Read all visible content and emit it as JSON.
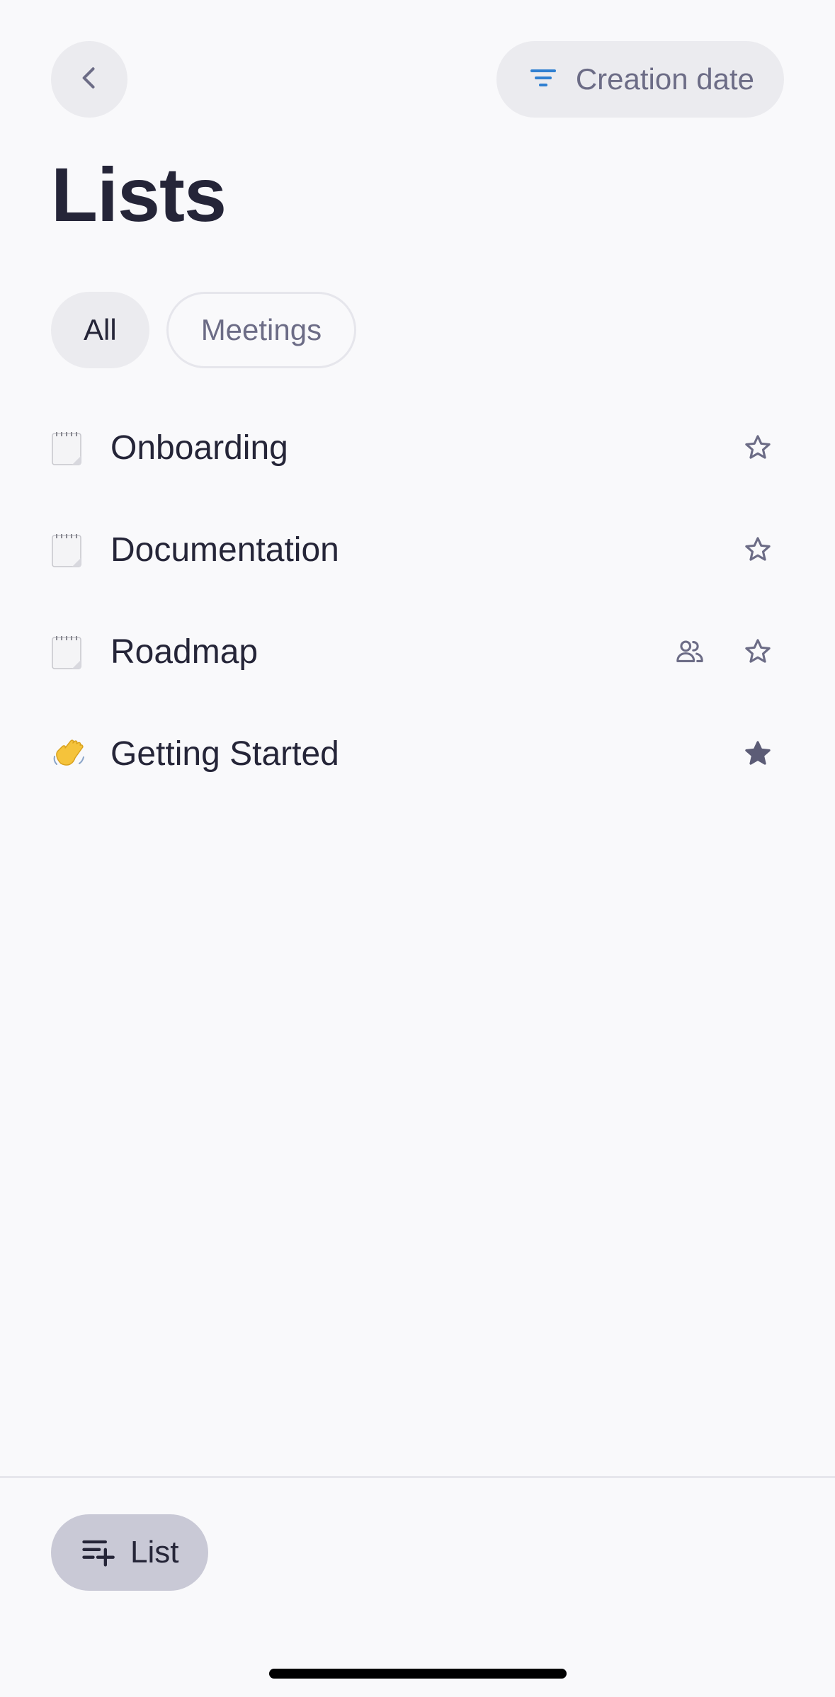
{
  "header": {
    "back_icon": "chevron-left-icon",
    "sort": {
      "icon": "sort-lines-icon",
      "label": "Creation date",
      "icon_color": "#2f7fd1"
    }
  },
  "page_title": "Lists",
  "filters": [
    {
      "label": "All",
      "selected": true
    },
    {
      "label": "Meetings",
      "selected": false
    }
  ],
  "lists": [
    {
      "emoji": "notepad-emoji",
      "title": "Onboarding",
      "shared": false,
      "favorite": false
    },
    {
      "emoji": "notepad-emoji",
      "title": "Documentation",
      "shared": false,
      "favorite": false
    },
    {
      "emoji": "notepad-emoji",
      "title": "Roadmap",
      "shared": true,
      "favorite": false
    },
    {
      "emoji": "waving-hand-emoji",
      "title": "Getting Started",
      "shared": false,
      "favorite": true
    }
  ],
  "footer": {
    "new_list_icon": "add-list-icon",
    "new_list_label": "List"
  },
  "colors": {
    "background": "#f9f9fb",
    "text_primary": "#252538",
    "text_secondary": "#6c6c86",
    "chip_bg": "#ebebef",
    "accent_blue": "#2f7fd1",
    "new_list_bg": "#c9c9d6"
  }
}
